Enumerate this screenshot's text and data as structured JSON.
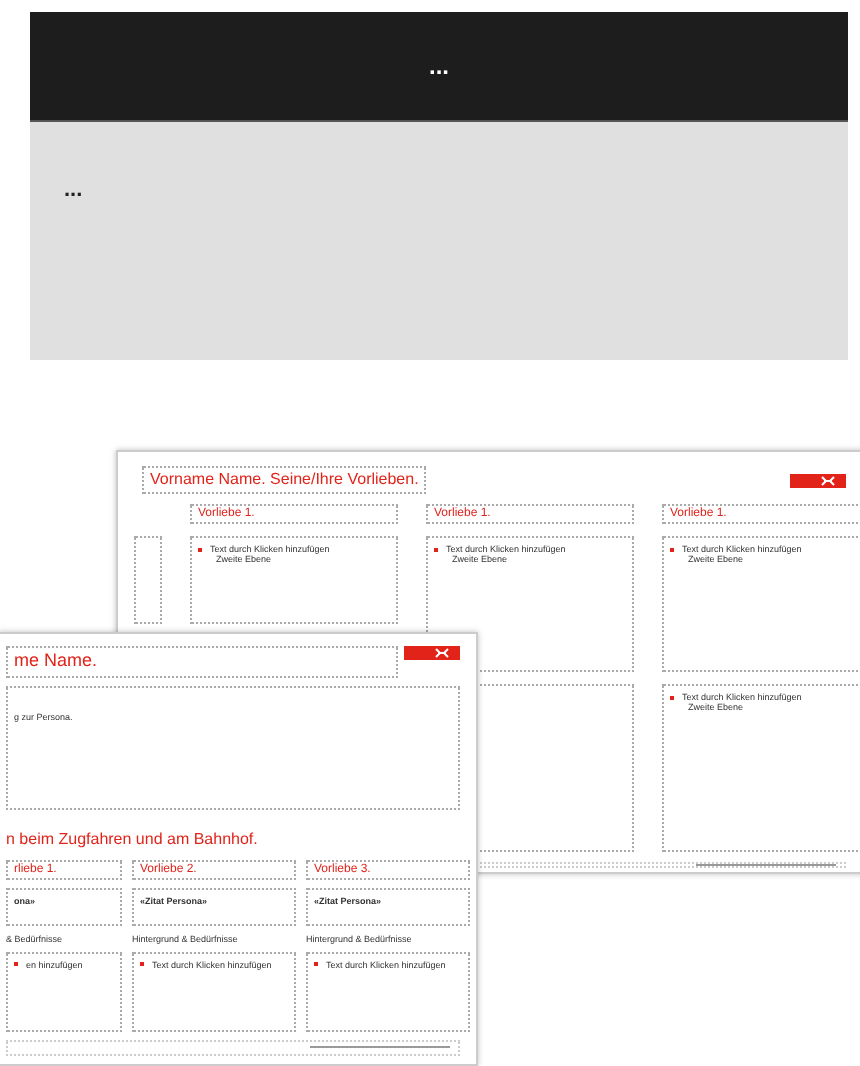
{
  "header": {
    "title": "..."
  },
  "panel": {
    "text": "..."
  },
  "back_slide": {
    "title": "Vorname Name. Seine/Ihre Vorlieben.",
    "columns": [
      {
        "heading": "Vorliebe 1.",
        "bullet": "Text durch Klicken hinzufügen",
        "sub_bullet": "Zweite Ebene"
      },
      {
        "heading": "Vorliebe 1.",
        "bullet": "Text durch Klicken hinzufügen",
        "sub_bullet": "Zweite Ebene"
      },
      {
        "heading": "Vorliebe 1.",
        "bullet": "Text durch Klicken hinzufügen",
        "sub_bullet": "Zweite Ebene"
      }
    ],
    "lower_box": {
      "bullet": "Text durch Klicken hinzufügen",
      "sub_bullet": "Zweite Ebene"
    }
  },
  "front_slide": {
    "title": "me Name.",
    "quote_text": "g zur Persona.",
    "section_title": "n beim Zugfahren und am Bahnhof.",
    "columns": [
      {
        "heading": "rliebe 1.",
        "quote": "ona»",
        "label": "& Bedürfnisse",
        "bullet": "en hinzufügen"
      },
      {
        "heading": "Vorliebe 2.",
        "quote": "«Zitat Persona»",
        "label": "Hintergrund & Bedürfnisse",
        "bullet": "Text durch Klicken hinzufügen"
      },
      {
        "heading": "Vorliebe 3.",
        "quote": "«Zitat Persona»",
        "label": "Hintergrund & Bedürfnisse",
        "bullet": "Text durch Klicken hinzufügen"
      }
    ]
  }
}
